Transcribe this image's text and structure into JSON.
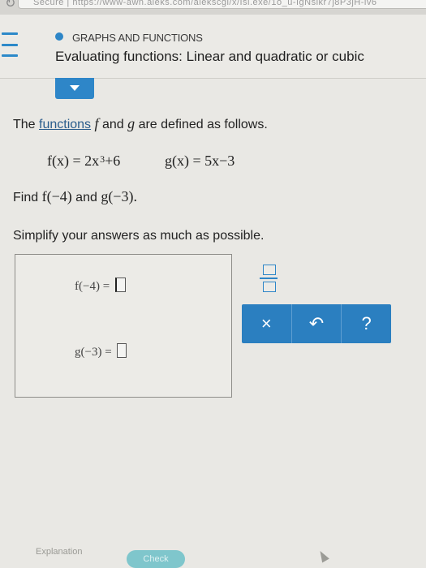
{
  "browser": {
    "url_text": "Secure  |  https://www-awn.aleks.com/alekscgi/x/Isl.exe/1o_u-IgNslkr7j8P3jH-lv6"
  },
  "header": {
    "menu_icon": "hamburger-icon",
    "breadcrumb": "GRAPHS AND FUNCTIONS",
    "title": "Evaluating functions: Linear and quadratic or cubic",
    "accent_color": "#2e86c8"
  },
  "problem": {
    "line1_prefix": "The ",
    "line1_link": "functions",
    "line1_f": "f",
    "line1_mid": " and ",
    "line1_g": "g",
    "line1_suffix": " are defined as follows.",
    "f_def_lhs": "f(x) = 2x",
    "f_def_exp": "3",
    "f_def_rhs": "+6",
    "g_def": "g(x) = 5x−3",
    "find_prefix": "Find ",
    "find_f": "f(−4)",
    "find_mid": " and ",
    "find_g": "g(−3).",
    "simplify": "Simplify your answers as much as possible."
  },
  "answers": {
    "f_label": "f(−4) =",
    "f_value": "",
    "g_label": "g(−3) =",
    "g_value": ""
  },
  "keypad": {
    "fraction_icon": "fraction-icon",
    "clear_label": "×",
    "undo_label": "↶",
    "help_label": "?"
  },
  "footer": {
    "explanation_label": "Explanation",
    "check_label": "Check"
  }
}
